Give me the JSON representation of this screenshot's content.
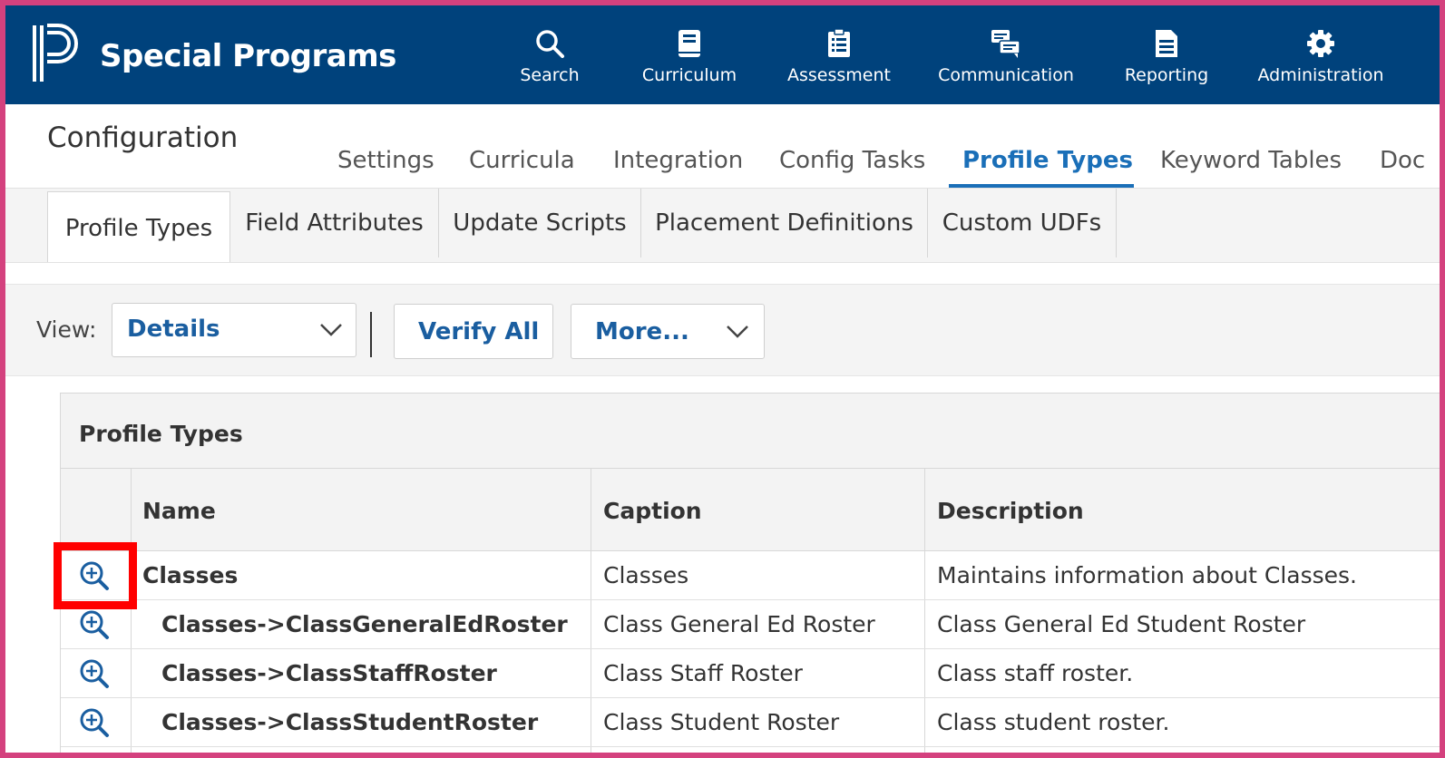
{
  "app": {
    "brand": "Special Programs"
  },
  "nav": [
    {
      "label": "Search",
      "icon": "search-icon"
    },
    {
      "label": "Curriculum",
      "icon": "book-icon"
    },
    {
      "label": "Assessment",
      "icon": "clipboard-icon"
    },
    {
      "label": "Communication",
      "icon": "chat-icon"
    },
    {
      "label": "Reporting",
      "icon": "document-icon"
    },
    {
      "label": "Administration",
      "icon": "gear-icon"
    }
  ],
  "config": {
    "title": "Configuration",
    "tabs": [
      "Settings",
      "Curricula",
      "Integration",
      "Config Tasks",
      "Profile Types",
      "Keyword Tables",
      "Doc"
    ],
    "active_tab": "Profile Types",
    "subtabs": [
      "Profile Types",
      "Field Attributes",
      "Update Scripts",
      "Placement Definitions",
      "Custom UDFs"
    ]
  },
  "toolbar": {
    "view_label": "View:",
    "view_value": "Details",
    "verify_all": "Verify All",
    "more": "More..."
  },
  "table": {
    "title": "Profile Types",
    "columns": [
      "Name",
      "Caption",
      "Description"
    ],
    "rows": [
      {
        "name": "Classes",
        "caption": "Classes",
        "description": "Maintains information about Classes."
      },
      {
        "name": "Classes->ClassGeneralEdRoster",
        "caption": "Class General Ed Roster",
        "description": "Class General Ed Student Roster"
      },
      {
        "name": "Classes->ClassStaffRoster",
        "caption": "Class Staff Roster",
        "description": "Class staff roster."
      },
      {
        "name": "Classes->ClassStudentRoster",
        "caption": "Class Student Roster",
        "description": "Class student roster."
      }
    ]
  },
  "colors": {
    "nav_bg": "#00427c",
    "accent": "#1a6fb8",
    "highlight": "#ff0000",
    "frame": "#d4417e"
  }
}
